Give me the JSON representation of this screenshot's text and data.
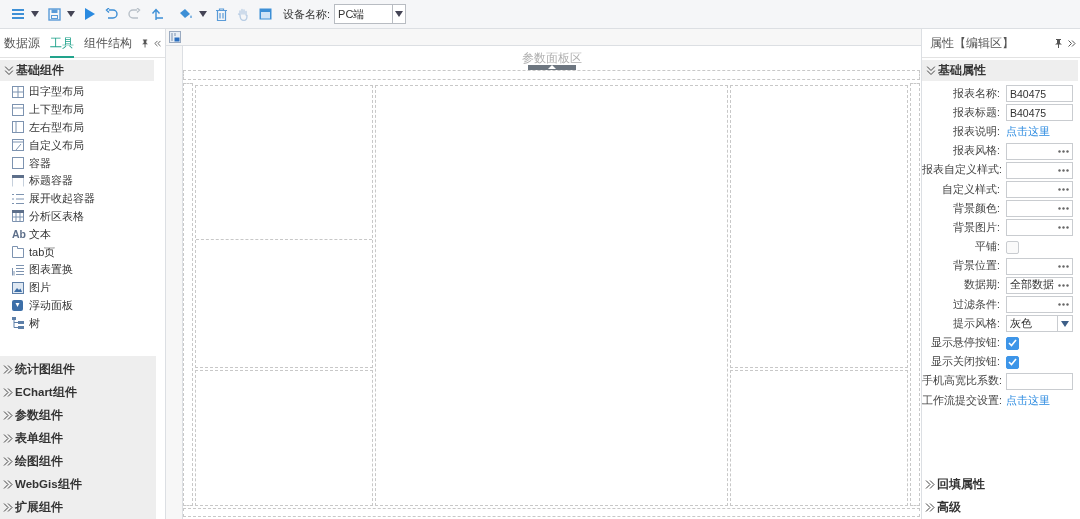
{
  "toolbar": {
    "device_label": "设备名称:",
    "device_select": "PC端"
  },
  "left_panel": {
    "tabs": [
      {
        "label": "数据源",
        "selected": false
      },
      {
        "label": "工具",
        "selected": true
      },
      {
        "label": "组件结构",
        "selected": false
      }
    ],
    "sections": [
      {
        "title": "基础组件",
        "expanded": true,
        "items": [
          {
            "label": "田字型布局"
          },
          {
            "label": "上下型布局"
          },
          {
            "label": "左右型布局"
          },
          {
            "label": "自定义布局"
          },
          {
            "label": "容器"
          },
          {
            "label": "标题容器"
          },
          {
            "label": "展开收起容器"
          },
          {
            "label": "分析区表格"
          },
          {
            "label": "文本",
            "icon_text": "Ab"
          },
          {
            "label": "tab页"
          },
          {
            "label": "图表置换"
          },
          {
            "label": "图片"
          },
          {
            "label": "浮动面板"
          },
          {
            "label": "树"
          }
        ]
      },
      {
        "title": "统计图组件",
        "expanded": false
      },
      {
        "title": "EChart组件",
        "expanded": false
      },
      {
        "title": "参数组件",
        "expanded": false
      },
      {
        "title": "表单组件",
        "expanded": false
      },
      {
        "title": "绘图组件",
        "expanded": false
      },
      {
        "title": "WebGis组件",
        "expanded": false
      },
      {
        "title": "扩展组件",
        "expanded": false
      }
    ]
  },
  "canvas": {
    "param_panel_label": "参数面板区"
  },
  "right_panel": {
    "title": "属性【编辑区】",
    "sections": [
      {
        "title": "基础属性",
        "expanded": true,
        "rows": [
          {
            "label": "报表名称:",
            "kind": "input",
            "value": "B40475"
          },
          {
            "label": "报表标题:",
            "kind": "input",
            "value": "B40475"
          },
          {
            "label": "报表说明:",
            "kind": "link",
            "text": "点击这里"
          },
          {
            "label": "报表风格:",
            "kind": "picker"
          },
          {
            "label": "报表自定义样式:",
            "kind": "picker"
          },
          {
            "label": "自定义样式:",
            "kind": "picker"
          },
          {
            "label": "背景颜色:",
            "kind": "picker"
          },
          {
            "label": "背景图片:",
            "kind": "picker"
          },
          {
            "label": "平铺:",
            "kind": "checkbox",
            "checked": false
          },
          {
            "label": "背景位置:",
            "kind": "picker"
          },
          {
            "label": "数据期:",
            "kind": "picker",
            "value": "全部数据"
          },
          {
            "label": "过滤条件:",
            "kind": "picker"
          },
          {
            "label": "提示风格:",
            "kind": "select",
            "value": "灰色"
          },
          {
            "label": "显示悬停按钮:",
            "kind": "checkbox",
            "checked": true
          },
          {
            "label": "显示关闭按钮:",
            "kind": "checkbox",
            "checked": true
          },
          {
            "label": "手机高宽比系数:",
            "kind": "input"
          },
          {
            "label": "工作流提交设置:",
            "kind": "link",
            "text": "点击这里"
          }
        ]
      },
      {
        "title": "回填属性",
        "expanded": false
      },
      {
        "title": "高级",
        "expanded": false
      }
    ]
  }
}
